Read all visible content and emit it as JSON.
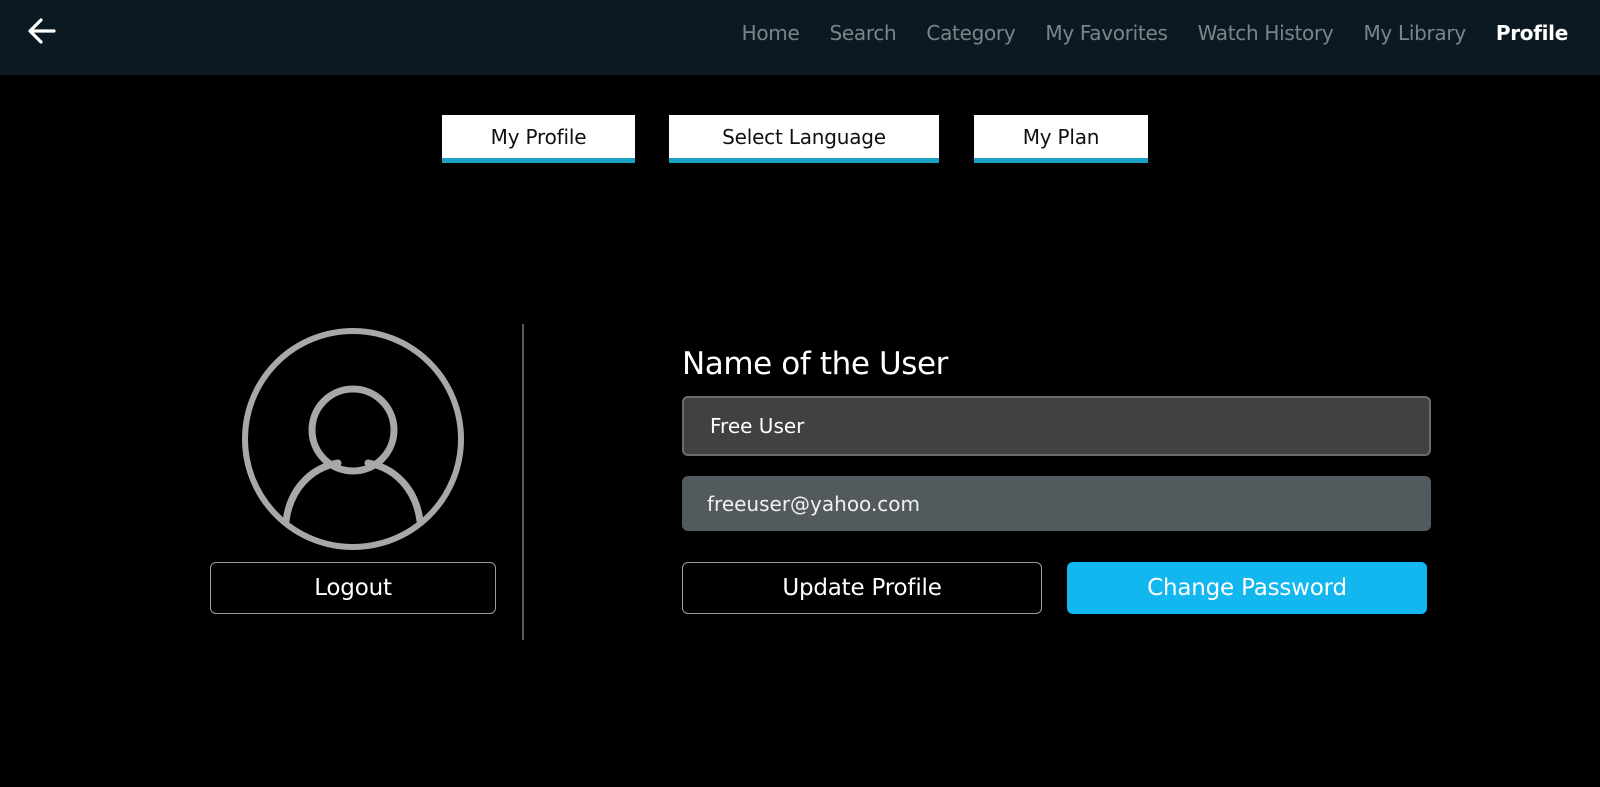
{
  "header": {
    "back_icon": "arrow-left-icon",
    "nav": [
      {
        "label": "Home",
        "active": false
      },
      {
        "label": "Search",
        "active": false
      },
      {
        "label": "Category",
        "active": false
      },
      {
        "label": "My Favorites",
        "active": false
      },
      {
        "label": "Watch History",
        "active": false
      },
      {
        "label": "My Library",
        "active": false
      },
      {
        "label": "Profile",
        "active": true
      }
    ]
  },
  "tabs": {
    "my_profile": "My Profile",
    "select_language": "Select Language",
    "my_plan": "My Plan"
  },
  "profile": {
    "avatar_icon": "user-avatar-icon",
    "logout_label": "Logout",
    "name_title": "Name of the User",
    "name_value": "Free User",
    "email_value": "freeuser@yahoo.com",
    "update_label": "Update Profile",
    "change_password_label": "Change Password"
  },
  "colors": {
    "header_bg": "#0b1a22",
    "page_bg": "#000000",
    "tab_accent": "#1ba3c4",
    "primary_button": "#12b7ef",
    "nav_inactive": "#7c848a",
    "nav_active": "#ffffff"
  }
}
